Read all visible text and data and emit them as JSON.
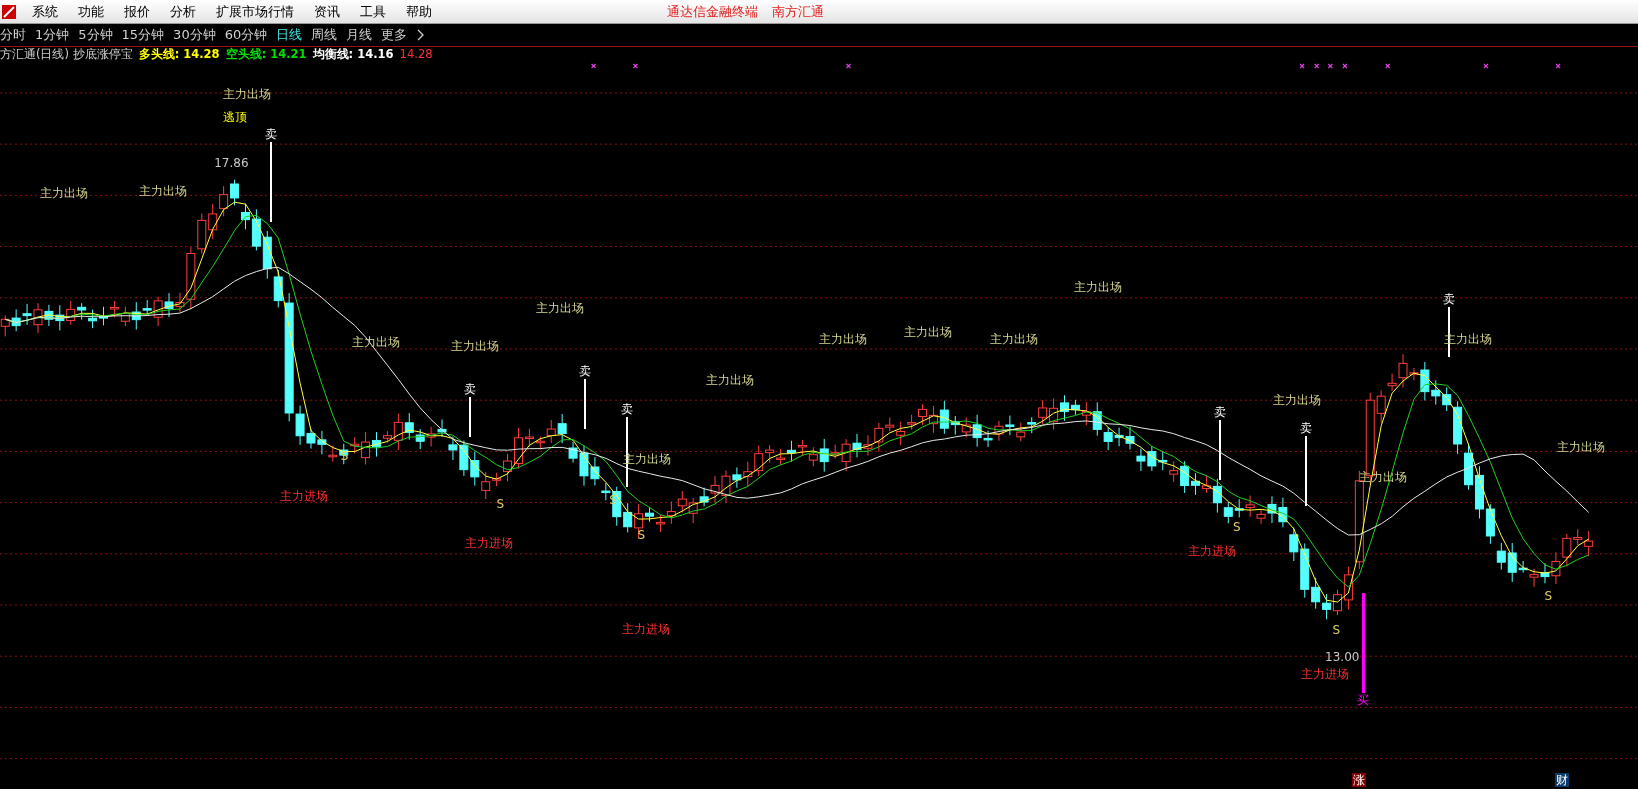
{
  "menu_bar": {
    "items": [
      "系统",
      "功能",
      "报价",
      "分析",
      "扩展市场行情",
      "资讯",
      "工具",
      "帮助"
    ],
    "right_links": [
      "通达信金融终端",
      "南方汇通"
    ]
  },
  "period_tabs": [
    {
      "label": "分时",
      "selected": false
    },
    {
      "label": "1分钟",
      "selected": false
    },
    {
      "label": "5分钟",
      "selected": false
    },
    {
      "label": "15分钟",
      "selected": false
    },
    {
      "label": "30分钟",
      "selected": false
    },
    {
      "label": "60分钟",
      "selected": false
    },
    {
      "label": "日线",
      "selected": true
    },
    {
      "label": "周线",
      "selected": false
    },
    {
      "label": "月线",
      "selected": false
    },
    {
      "label": "更多",
      "selected": false
    }
  ],
  "legend": {
    "title": "方汇通(日线) 抄底涨停宝",
    "indicators": [
      {
        "name": "多头线:",
        "value": "14.28",
        "color": "#ffff00"
      },
      {
        "name": "空头线:",
        "value": "14.21",
        "color": "#00e000"
      },
      {
        "name": "均衡线:",
        "value": "14.16",
        "color": "#ffffff"
      }
    ],
    "last_value": "14.28"
  },
  "annotations": [
    {
      "kind": "exit",
      "text": "主力出场"
    },
    {
      "kind": "top",
      "text": "逃顶"
    },
    {
      "kind": "sell",
      "text": "卖"
    },
    {
      "kind": "price",
      "text": "17.86"
    },
    {
      "kind": "exit",
      "text": "主力出场"
    },
    {
      "kind": "exit",
      "text": "主力出场"
    },
    {
      "kind": "exit",
      "text": "主力出场"
    },
    {
      "kind": "exit",
      "text": "主力出场"
    },
    {
      "kind": "sell",
      "text": "卖"
    },
    {
      "kind": "exit",
      "text": "主力出场"
    },
    {
      "kind": "exit",
      "text": "主力出场"
    },
    {
      "kind": "exit",
      "text": "主力出场"
    },
    {
      "kind": "exit",
      "text": "主力出场"
    },
    {
      "kind": "exit",
      "text": "主力出场"
    },
    {
      "kind": "exit",
      "text": "主力出场"
    },
    {
      "kind": "sell",
      "text": "卖"
    },
    {
      "kind": "sell",
      "text": "卖"
    },
    {
      "kind": "exit",
      "text": "主力出场"
    },
    {
      "kind": "sell",
      "text": "卖"
    },
    {
      "kind": "sell",
      "text": "卖"
    },
    {
      "kind": "exit",
      "text": "主力出场"
    },
    {
      "kind": "sell",
      "text": "卖"
    },
    {
      "kind": "s",
      "text": "S"
    },
    {
      "kind": "exit",
      "text": "主力出场"
    },
    {
      "kind": "exit",
      "text": "主力出场"
    },
    {
      "kind": "exit",
      "text": "主力出场"
    },
    {
      "kind": "entry",
      "text": "主力进场"
    },
    {
      "kind": "s",
      "text": "S"
    },
    {
      "kind": "s",
      "text": "S"
    },
    {
      "kind": "entry",
      "text": "主力进场"
    },
    {
      "kind": "s",
      "text": "S"
    },
    {
      "kind": "entry",
      "text": "主力进场"
    },
    {
      "kind": "s",
      "text": "S"
    },
    {
      "kind": "s",
      "text": "S"
    },
    {
      "kind": "entry",
      "text": "主力进场"
    },
    {
      "kind": "s",
      "text": "S"
    },
    {
      "kind": "price",
      "text": "13.00"
    },
    {
      "kind": "entry",
      "text": "主力进场"
    },
    {
      "kind": "buy",
      "text": "买"
    }
  ],
  "bottom_markers": [
    {
      "text": "涨",
      "color": "#800000"
    },
    {
      "text": "财",
      "color": "#0a3a6a"
    }
  ]
}
